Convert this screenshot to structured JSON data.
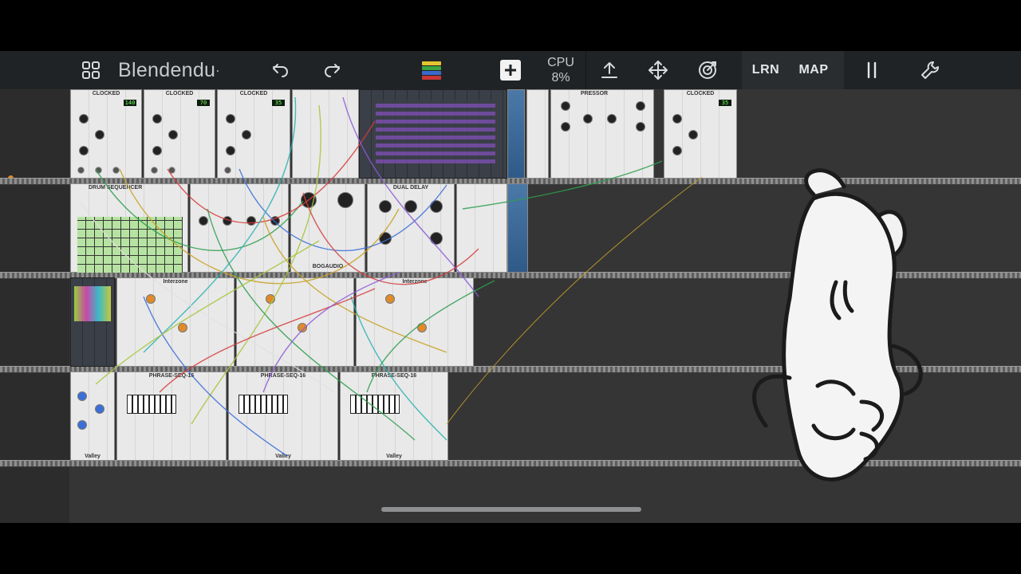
{
  "toolbar": {
    "patch_title": "Blendendu",
    "unsaved_marker": "·",
    "cpu_label": "CPU",
    "cpu_value": "8%",
    "learn_label": "LRN",
    "map_label": "MAP"
  },
  "modules": {
    "clocked_1": "CLOCKED",
    "clocked_2": "CLOCKED",
    "clocked_3": "CLOCKED",
    "clocked_4": "CLOCKED",
    "bpm_1": "140",
    "bpm_2": "70",
    "bpm_3": "35",
    "bpm_4": "35",
    "drum_sequencer": "DRUM SEQUENCER",
    "dual_delay": "DUAL DELAY",
    "pressor": "PRESSOR",
    "interzone_1": "Interzone",
    "interzone_2": "Interzone",
    "phrase_seq_1": "PHRASE-SEQ-16",
    "phrase_seq_2": "PHRASE-SEQ-16",
    "phrase_seq_3": "PHRASE-SEQ-16",
    "valley_1": "Valley",
    "valley_2": "Valley",
    "valley_3": "Valley",
    "bogaudio": "BOGAUDIO"
  },
  "colors": {
    "toolbar_bg": "#202325",
    "canvas_bg": "#353535",
    "module_panel": "#e9e9e9",
    "cable_colors": [
      "#2e9e4f",
      "#c9a227",
      "#d63c3c",
      "#3c6fd6",
      "#2bb0b0",
      "#a4c639",
      "#8c5bd6",
      "#e0e0e0"
    ]
  }
}
